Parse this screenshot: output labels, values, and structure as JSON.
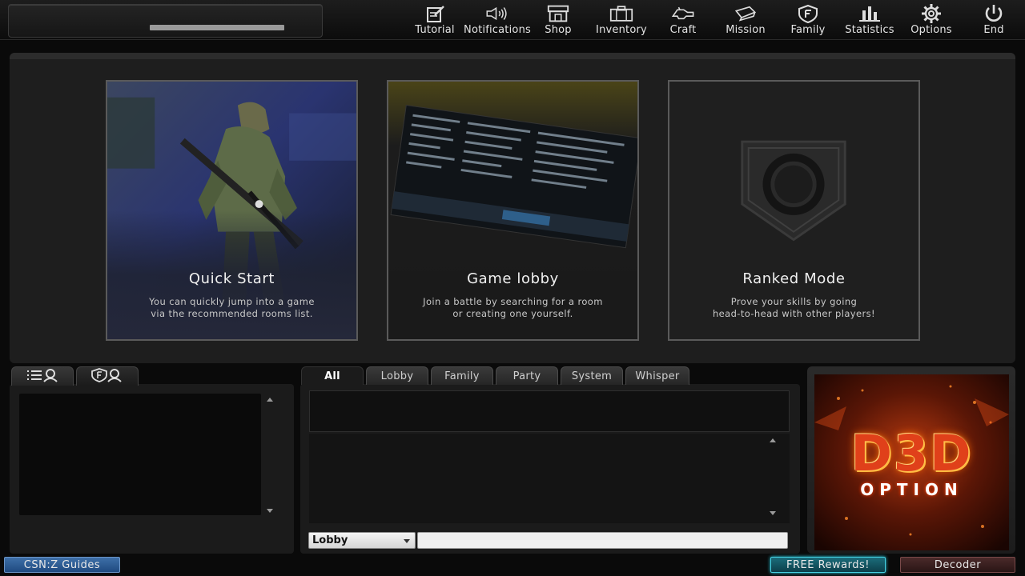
{
  "topbar": {
    "nav": [
      {
        "label": "Tutorial",
        "icon": "tutorial-icon"
      },
      {
        "label": "Notifications",
        "icon": "speaker-icon"
      },
      {
        "label": "Shop",
        "icon": "shop-icon"
      },
      {
        "label": "Inventory",
        "icon": "briefcase-icon"
      },
      {
        "label": "Craft",
        "icon": "craft-icon"
      },
      {
        "label": "Mission",
        "icon": "mission-icon"
      },
      {
        "label": "Family",
        "icon": "family-icon"
      },
      {
        "label": "Statistics",
        "icon": "statistics-icon"
      },
      {
        "label": "Options",
        "icon": "gear-icon"
      },
      {
        "label": "End",
        "icon": "power-icon"
      }
    ]
  },
  "cards": [
    {
      "title": "Quick Start",
      "desc1": "You can quickly jump into a game",
      "desc2": "via the recommended rooms list."
    },
    {
      "title": "Game lobby",
      "desc1": "Join a battle by searching for a room",
      "desc2": "or creating one yourself."
    },
    {
      "title": "Ranked Mode",
      "desc1": "Prove your skills by going",
      "desc2": "head-to-head with other players!"
    }
  ],
  "left_tabs": [
    {
      "icon": "friend-list-icon"
    },
    {
      "icon": "family-members-icon"
    }
  ],
  "chat": {
    "tabs": [
      "All",
      "Lobby",
      "Family",
      "Party",
      "System",
      "Whisper"
    ],
    "active_tab": "All",
    "channel": "Lobby",
    "input_value": ""
  },
  "ad": {
    "line1": "D3D",
    "line2": "OPTION"
  },
  "buttons": {
    "guides": "CSN:Z Guides",
    "rewards": "FREE Rewards!",
    "decoder": "Decoder"
  },
  "colors": {
    "guides_bg": "#2e5c94",
    "rewards_glow": "#2bd6ec",
    "decoder_bg": "#3a2020",
    "ad_red": "#e0401a"
  }
}
